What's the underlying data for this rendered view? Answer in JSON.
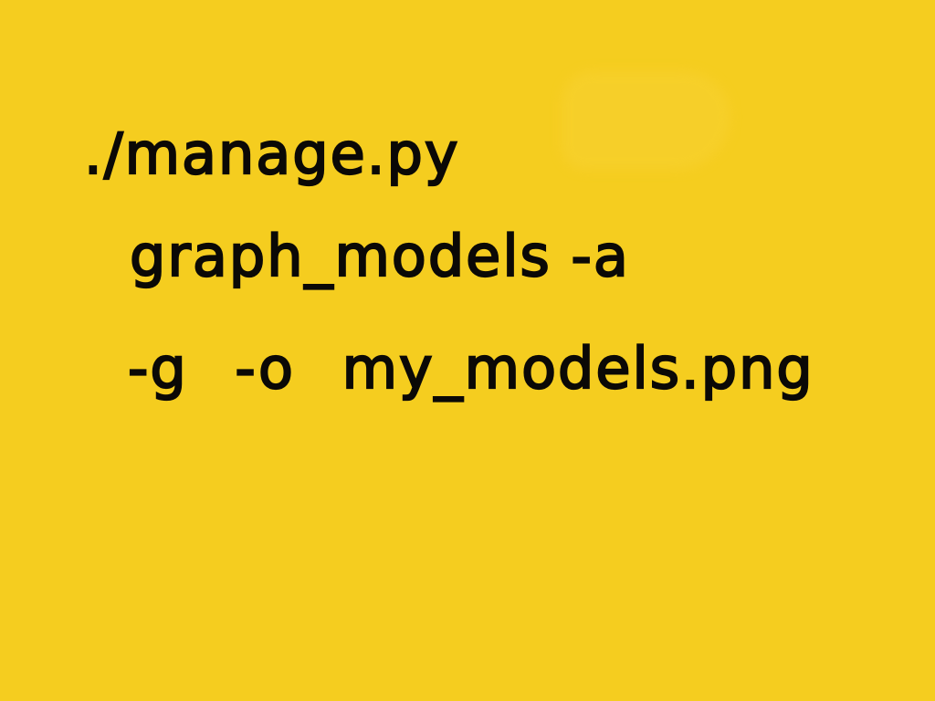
{
  "note": {
    "lines": [
      "./manage.py",
      "graph_models -a",
      "-g -o my_models.png"
    ]
  },
  "colors": {
    "paper": "#f5cd1f",
    "ink": "#0b0906"
  }
}
